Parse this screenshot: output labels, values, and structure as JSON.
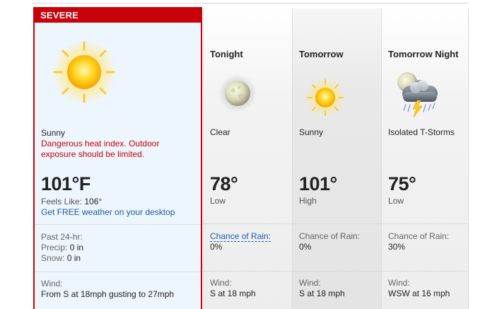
{
  "current": {
    "badge": "SEVERE",
    "condition": "Sunny",
    "alert": "Dangerous heat index. Outdoor exposure should be limited.",
    "temp": "101°F",
    "feels_like_label": "Feels Like:",
    "feels_like_value": "106°",
    "desktop_link": "Get FREE weather on your desktop",
    "past24_label": "Past 24-hr:",
    "precip_label": "Precip:",
    "precip_value": "0 in",
    "snow_label": "Snow:",
    "snow_value": "0 in",
    "wind_label": "Wind:",
    "wind_value": "From S at 18mph gusting to 27mph",
    "icon": "sun-icon"
  },
  "forecast": [
    {
      "period": "Tonight",
      "condition": "Clear",
      "temp": "78°",
      "hilo": "Low",
      "rain_label": "Chance of Rain:",
      "rain_value": "0%",
      "wind_label": "Wind:",
      "wind_value": "S at 18 mph",
      "icon": "moon-icon"
    },
    {
      "period": "Tomorrow",
      "condition": "Sunny",
      "temp": "101°",
      "hilo": "High",
      "rain_label": "Chance of Rain:",
      "rain_value": "0%",
      "wind_label": "Wind:",
      "wind_value": "S at 18 mph",
      "icon": "sun-icon"
    },
    {
      "period": "Tomorrow Night",
      "condition": "Isolated T-Storms",
      "temp": "75°",
      "hilo": "Low",
      "rain_label": "Chance of Rain:",
      "rain_value": "30%",
      "wind_label": "Wind:",
      "wind_value": "WSW at 16 mph",
      "icon": "thunderstorm-night-icon"
    }
  ],
  "colors": {
    "severe": "#c8000a",
    "link": "#1a5aa8",
    "current_bg": "#eef6fd"
  }
}
